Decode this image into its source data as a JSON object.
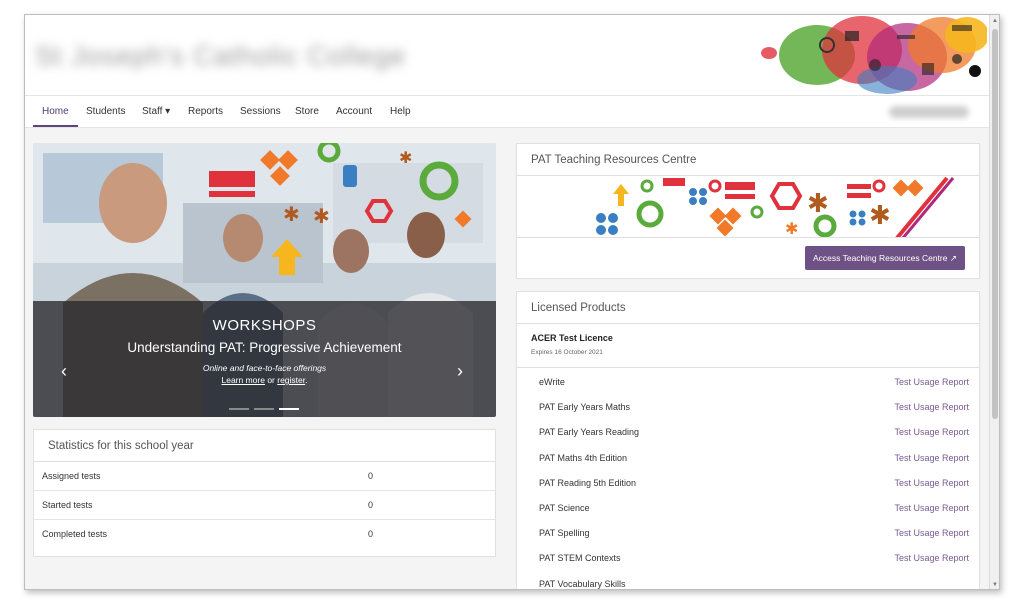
{
  "header": {
    "school_name": "St Joseph's Catholic College"
  },
  "nav": {
    "items": [
      {
        "label": "Home"
      },
      {
        "label": "Students"
      },
      {
        "label": "Staff ▾"
      },
      {
        "label": "Reports"
      },
      {
        "label": "Sessions"
      },
      {
        "label": "Store"
      },
      {
        "label": "Account"
      },
      {
        "label": "Help"
      }
    ],
    "active": "Home"
  },
  "carousel": {
    "title": "WORKSHOPS",
    "subtitle": "Understanding PAT: Progressive Achievement",
    "tagline": "Online and face-to-face offerings",
    "learn_more": "Learn more",
    "or": " or ",
    "register": "register",
    "period": ".",
    "prev_glyph": "‹",
    "next_glyph": "›"
  },
  "stats": {
    "heading": "Statistics for this school year",
    "rows": [
      {
        "label": "Assigned tests",
        "value": "0"
      },
      {
        "label": "Started tests",
        "value": "0"
      },
      {
        "label": "Completed tests",
        "value": "0"
      }
    ]
  },
  "trc": {
    "heading": "PAT Teaching Resources Centre",
    "button": "Access Teaching Resources Centre"
  },
  "licensed": {
    "heading": "Licensed Products",
    "licence_name": "ACER Test Licence",
    "licence_expiry": "Expires 16 October 2021",
    "link_label": "Test Usage Report",
    "products": [
      {
        "name": "eWrite"
      },
      {
        "name": "PAT Early Years Maths"
      },
      {
        "name": "PAT Early Years Reading"
      },
      {
        "name": "PAT Maths 4th Edition"
      },
      {
        "name": "PAT Reading 5th Edition"
      },
      {
        "name": "PAT Science"
      },
      {
        "name": "PAT Spelling"
      },
      {
        "name": "PAT STEM Contexts"
      },
      {
        "name": "PAT Vocabulary Skills"
      }
    ]
  },
  "colors": {
    "accent": "#6e5285",
    "link": "#7a5a92",
    "brand_orange": "#f07a2a",
    "brand_red": "#e0323c",
    "brand_green": "#5aaa3c",
    "brand_yellow": "#f6b61e",
    "brand_blue": "#3a7fc1"
  },
  "icons": [
    "external-link-icon",
    "chevron-left-icon",
    "chevron-right-icon",
    "caret-down-icon"
  ]
}
